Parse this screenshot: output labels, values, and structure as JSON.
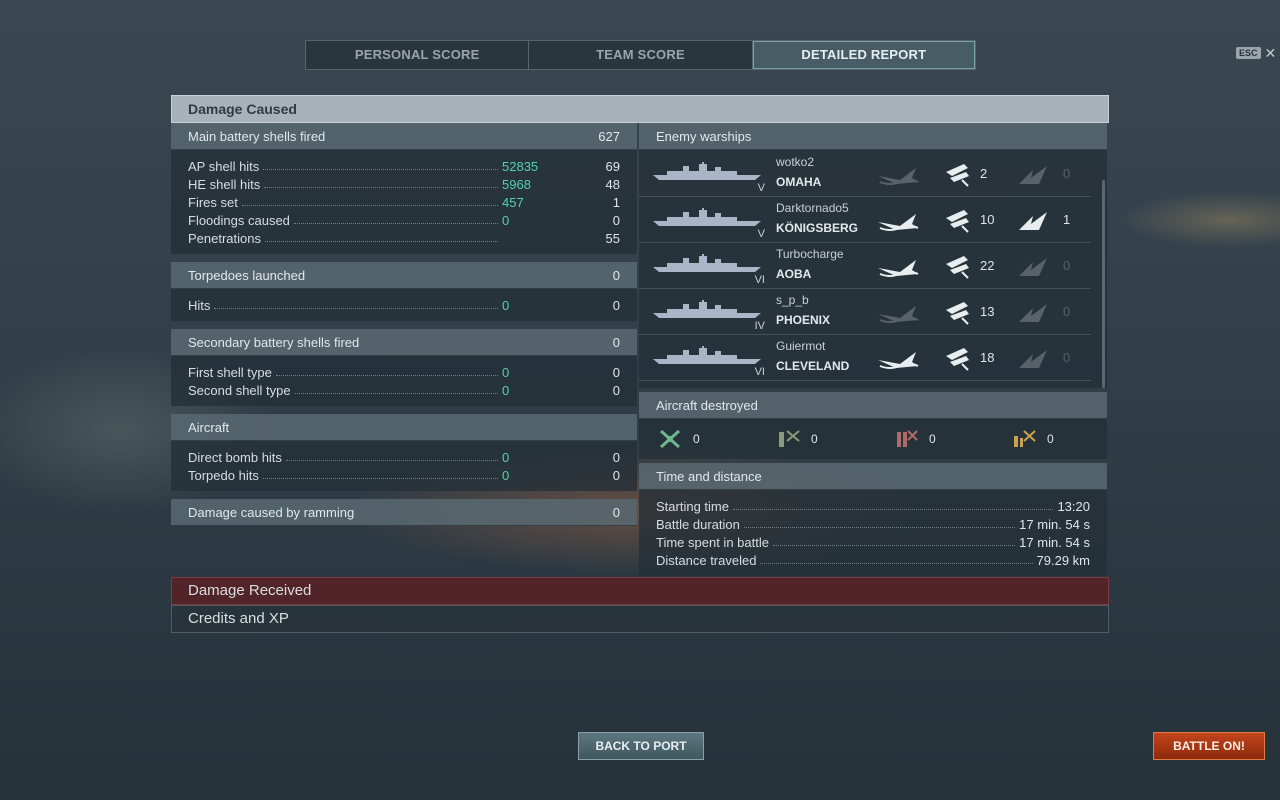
{
  "tabs": [
    "PERSONAL SCORE",
    "TEAM SCORE",
    "DETAILED REPORT"
  ],
  "esc_label": "ESC",
  "damage_caused_title": "Damage Caused",
  "main_battery": {
    "label": "Main battery shells fired",
    "total": "627",
    "rows": [
      {
        "label": "AP shell hits",
        "green": "52835",
        "value": "69"
      },
      {
        "label": "HE shell hits",
        "green": "5968",
        "value": "48"
      },
      {
        "label": "Fires set",
        "green": "457",
        "value": "1"
      },
      {
        "label": "Floodings caused",
        "green": "0",
        "value": "0"
      },
      {
        "label": "Penetrations",
        "green": "",
        "value": "55"
      }
    ]
  },
  "torpedoes": {
    "label": "Torpedoes launched",
    "total": "0",
    "rows": [
      {
        "label": "Hits",
        "green": "0",
        "value": "0"
      }
    ]
  },
  "secondary": {
    "label": "Secondary battery shells fired",
    "total": "0",
    "rows": [
      {
        "label": "First shell type",
        "green": "0",
        "value": "0"
      },
      {
        "label": "Second shell type",
        "green": "0",
        "value": "0"
      }
    ]
  },
  "aircraft": {
    "label": "Aircraft",
    "rows": [
      {
        "label": "Direct bomb hits",
        "green": "0",
        "value": "0"
      },
      {
        "label": "Torpedo hits",
        "green": "0",
        "value": "0"
      }
    ]
  },
  "ramming": {
    "label": "Damage caused by ramming",
    "total": "0"
  },
  "enemy_warships": {
    "label": "Enemy warships",
    "ships": [
      {
        "player": "wotko2",
        "ship": "OMAHA",
        "tier": "V",
        "frag_active": false,
        "hits": "2",
        "crit_active": false,
        "crits": "0"
      },
      {
        "player": "Darktornado5",
        "ship": "KÖNIGSBERG",
        "tier": "V",
        "frag_active": true,
        "hits": "10",
        "crit_active": true,
        "crits": "1"
      },
      {
        "player": "Turbocharge",
        "ship": "AOBA",
        "tier": "VI",
        "frag_active": true,
        "hits": "22",
        "crit_active": false,
        "crits": "0"
      },
      {
        "player": "s_p_b",
        "ship": "PHOENIX",
        "tier": "IV",
        "frag_active": false,
        "hits": "13",
        "crit_active": false,
        "crits": "0"
      },
      {
        "player": "Guiermot",
        "ship": "CLEVELAND",
        "tier": "VI",
        "frag_active": true,
        "hits": "18",
        "crit_active": false,
        "crits": "0"
      }
    ]
  },
  "aircraft_destroyed": {
    "label": "Aircraft destroyed",
    "items": [
      {
        "icon": "fighter-plane-icon",
        "count": "0"
      },
      {
        "icon": "torpedo-bomber-icon",
        "count": "0"
      },
      {
        "icon": "dive-bomber-icon",
        "count": "0"
      },
      {
        "icon": "spotter-plane-icon",
        "count": "0"
      }
    ]
  },
  "time_distance": {
    "label": "Time and distance",
    "rows": [
      {
        "label": "Starting time",
        "value": "13:20"
      },
      {
        "label": "Battle duration",
        "value": "17 min. 54 s"
      },
      {
        "label": "Time spent in battle",
        "value": "17 min. 54 s"
      },
      {
        "label": "Distance traveled",
        "value": "79.29 km"
      }
    ]
  },
  "damage_received_title": "Damage Received",
  "credits_xp_title": "Credits and XP",
  "buttons": {
    "back": "BACK TO PORT",
    "battle": "BATTLE ON!"
  },
  "colors": {
    "accent_green": "#4fd3a8",
    "battle_button": "#b53c16",
    "header_bar": "#a7b3b8"
  }
}
